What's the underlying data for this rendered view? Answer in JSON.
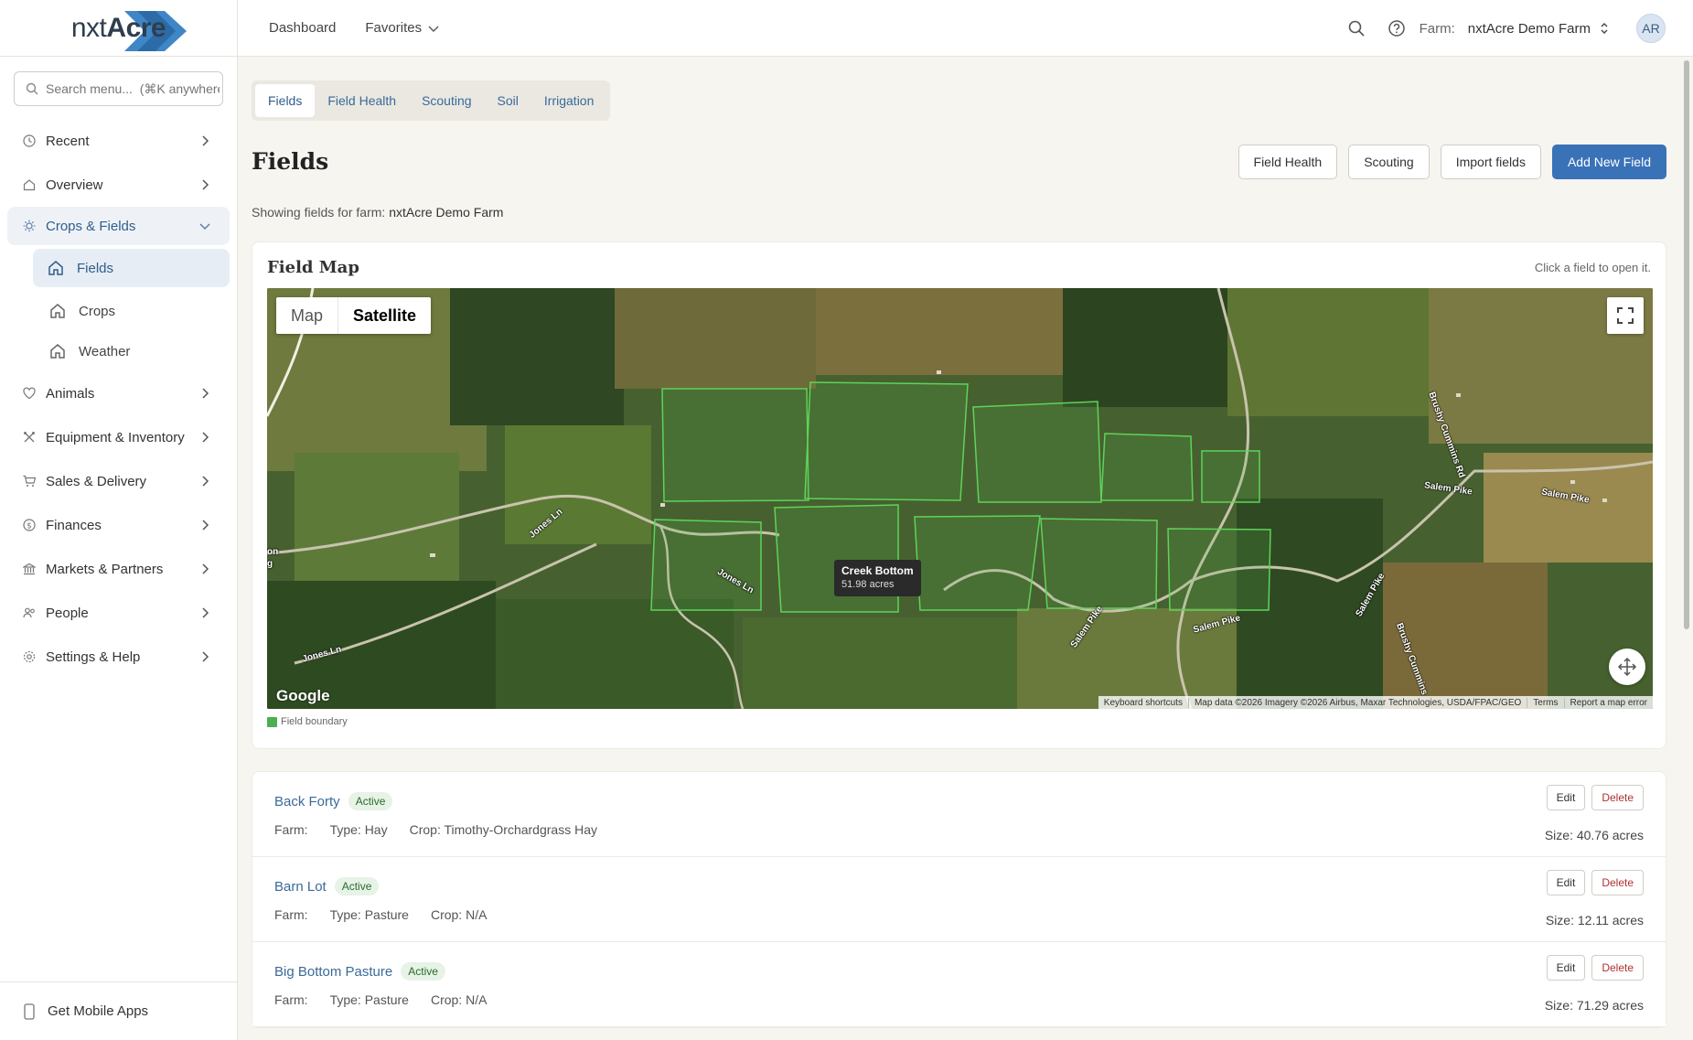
{
  "app": {
    "logo_part1": "nxt",
    "logo_part2": "Acre"
  },
  "sidebar": {
    "search_placeholder": "Search menu...  (⌘K anywhere)",
    "items": [
      {
        "label": "Recent",
        "icon": "clock-icon"
      },
      {
        "label": "Overview",
        "icon": "home-icon"
      },
      {
        "label": "Crops & Fields",
        "icon": "sun-icon",
        "open": true
      },
      {
        "label": "Animals",
        "icon": "heart-icon"
      },
      {
        "label": "Equipment & Inventory",
        "icon": "tools-icon"
      },
      {
        "label": "Sales & Delivery",
        "icon": "cart-icon"
      },
      {
        "label": "Finances",
        "icon": "dollar-icon"
      },
      {
        "label": "Markets & Partners",
        "icon": "bank-icon"
      },
      {
        "label": "People",
        "icon": "people-icon"
      },
      {
        "label": "Settings & Help",
        "icon": "gear-icon"
      }
    ],
    "sub_items": [
      {
        "label": "Fields",
        "active": true
      },
      {
        "label": "Crops"
      },
      {
        "label": "Weather"
      }
    ],
    "bottom_label": "Get Mobile Apps"
  },
  "header": {
    "dashboard": "Dashboard",
    "favorites": "Favorites",
    "farm_label": "Farm:",
    "farm_name": "nxtAcre Demo Farm",
    "avatar": "AR"
  },
  "tabs": [
    "Fields",
    "Field Health",
    "Scouting",
    "Soil",
    "Irrigation"
  ],
  "page": {
    "title": "Fields",
    "actions": [
      "Field Health",
      "Scouting",
      "Import fields",
      "Add New Field"
    ],
    "subtitle_prefix": "Showing fields for farm:",
    "subtitle_farm": "nxtAcre Demo Farm"
  },
  "map": {
    "title": "Field Map",
    "hint": "Click a field to open it.",
    "toggle": [
      "Map",
      "Satellite"
    ],
    "tooltip_name": "Creek Bottom",
    "tooltip_size": "51.98 acres",
    "google": "Google",
    "attribution": [
      "Keyboard shortcuts",
      "Map data ©2026 Imagery ©2026 Airbus, Maxar Technologies, USDA/FPAC/GEO",
      "Terms",
      "Report a map error"
    ],
    "roads": [
      "Jones Ln",
      "Jones Ln",
      "Jones Ln",
      "Salem Pike",
      "Salem Pike",
      "Salem Pike",
      "Salem Pike",
      "Salem Pike",
      "Brushy Cummins Rd",
      "Brushy Cummins",
      "on",
      "g"
    ],
    "legend": "Field boundary",
    "colors": {
      "field_boundary": "#4caf50",
      "accent": "#3a72b8"
    }
  },
  "fields": [
    {
      "name": "Back Forty",
      "status": "Active",
      "farm": "Farm:",
      "type": "Type: Hay",
      "crop": "Crop: Timothy-Orchardgrass Hay",
      "size": "Size: 40.76 acres"
    },
    {
      "name": "Barn Lot",
      "status": "Active",
      "farm": "Farm:",
      "type": "Type: Pasture",
      "crop": "Crop: N/A",
      "size": "Size: 12.11 acres"
    },
    {
      "name": "Big Bottom Pasture",
      "status": "Active",
      "farm": "Farm:",
      "type": "Type: Pasture",
      "crop": "Crop: N/A",
      "size": "Size: 71.29 acres"
    }
  ],
  "row_actions": {
    "edit": "Edit",
    "delete": "Delete"
  }
}
